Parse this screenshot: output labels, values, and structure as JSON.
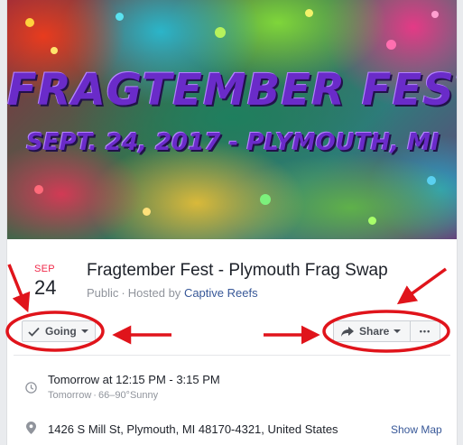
{
  "cover": {
    "title": "FRAGTEMBER FEST",
    "subtitle": "SEPT. 24, 2017 - PLYMOUTH, MI"
  },
  "event": {
    "month": "SEP",
    "day": "24",
    "title": "Fragtember Fest - Plymouth Frag Swap",
    "privacy": "Public",
    "separator": "·",
    "hosted_by_prefix": "Hosted by",
    "host": "Captive Reefs"
  },
  "actions": {
    "going_label": "Going",
    "share_label": "Share",
    "more_label": "•••"
  },
  "details": {
    "time": "Tomorrow at 12:15 PM - 3:15 PM",
    "weather_day": "Tomorrow",
    "separator": "·",
    "weather": "66–90°Sunny",
    "address": "1426 S Mill St, Plymouth, MI 48170-4321, United States",
    "show_map": "Show Map"
  },
  "icons": {
    "going": "checkmark-icon",
    "share": "share-arrow-icon",
    "more": "ellipsis-icon",
    "time": "clock-icon",
    "location": "map-pin-icon"
  },
  "colors": {
    "month": "#f02849",
    "link": "#385898",
    "annotation": "#e0141b",
    "title_art": "#6a2bc9"
  }
}
